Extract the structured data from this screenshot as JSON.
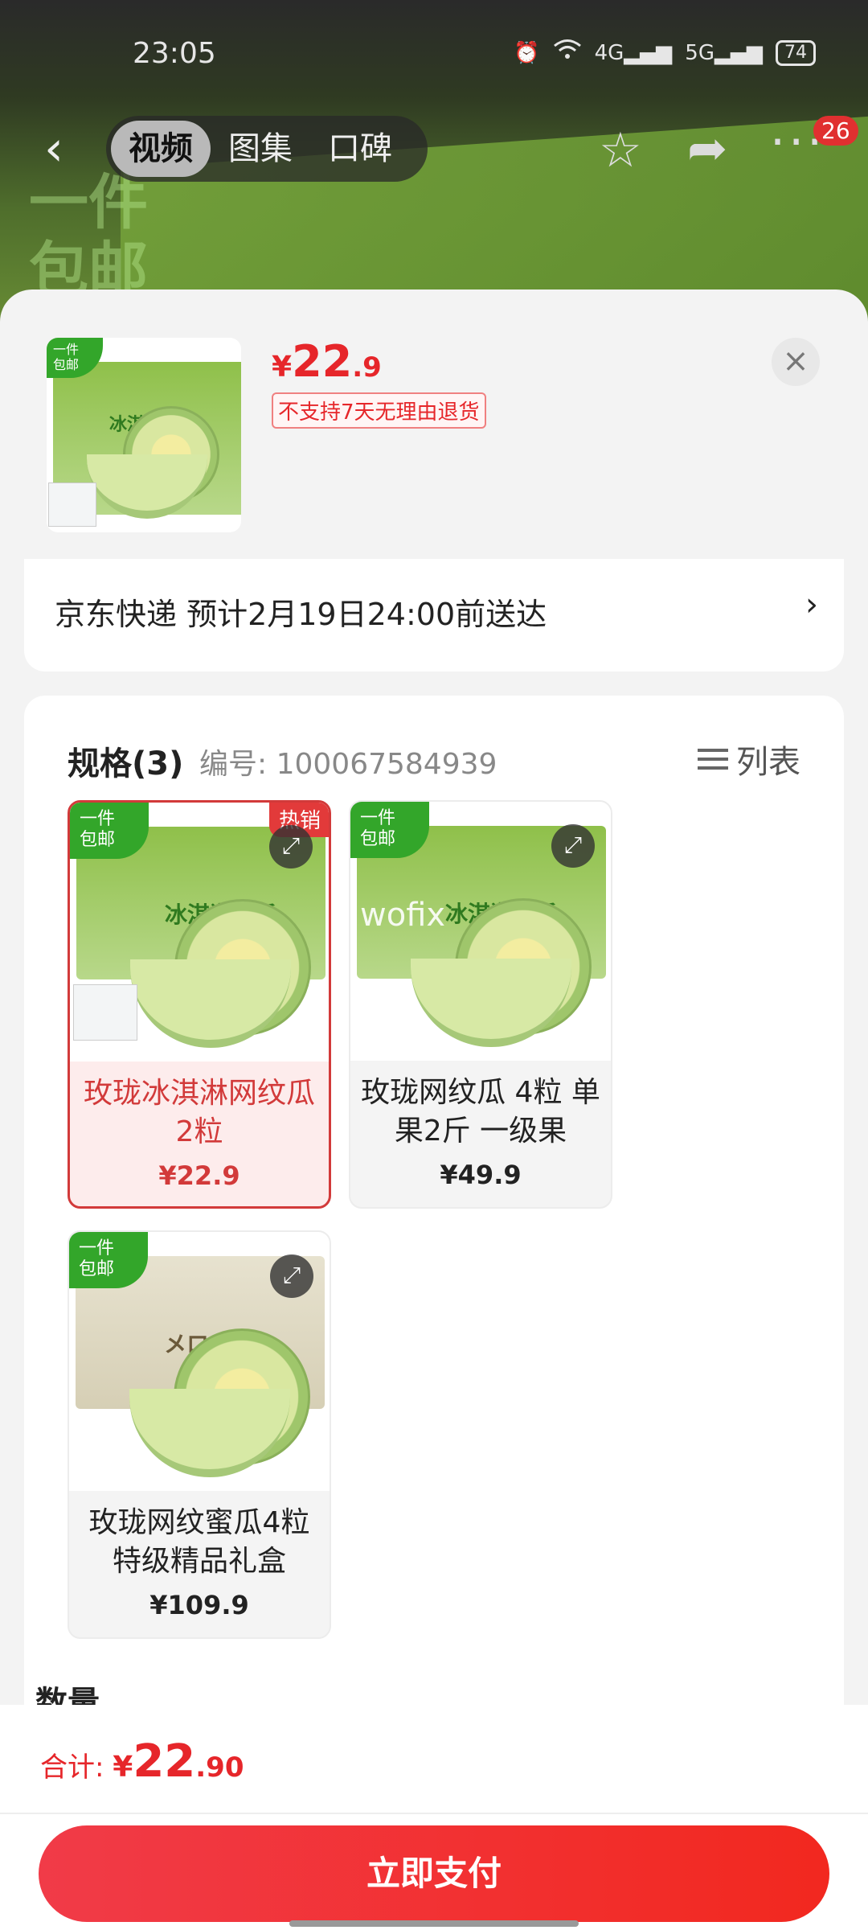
{
  "status": {
    "time": "23:05",
    "net1": "4G",
    "net2": "5G",
    "battery": "74"
  },
  "topbar": {
    "tabs": [
      "视频",
      "图集",
      "口碑"
    ],
    "active_tab": 0,
    "more_badge": "26"
  },
  "background": {
    "box_text_line1": "一件",
    "box_text_line2": "包邮"
  },
  "product": {
    "price_currency": "¥",
    "price_int": "22",
    "price_dec": ".9",
    "return_notice": "不支持7天无理由退货",
    "thumb_tag_line1": "一件",
    "thumb_tag_line2": "包邮",
    "box_label": "冰淇淋蜜瓜"
  },
  "delivery": {
    "text": "京东快递 预计2月19日24:00前送达"
  },
  "spec": {
    "title": "规格(3)",
    "code": "编号: 100067584939",
    "list_label": "列表",
    "options": [
      {
        "name": "玫珑冰淇淋网纹瓜 2粒",
        "price": "¥22.9",
        "hot": "热销",
        "tag1": "一件",
        "tag2": "包邮",
        "box_label": "冰淇淋蜜瓜",
        "selected": true
      },
      {
        "name": "玫珑网纹瓜 4粒 单果2斤  一级果",
        "price": "¥49.9",
        "tag1": "一件",
        "tag2": "包邮",
        "box_label": "冰淇淋蜜瓜",
        "watermark": "wofix",
        "selected": false
      },
      {
        "name": "玫珑网纹蜜瓜4粒 特级精品礼盒",
        "price": "¥109.9",
        "tag1": "一件",
        "tag2": "包邮",
        "box_label": "メロン",
        "selected": false
      }
    ]
  },
  "quantity": {
    "label": "数量"
  },
  "footer": {
    "total_label": "合计: ",
    "total_currency": "¥",
    "total_int": "22",
    "total_dec": ".90",
    "pay_label": "立即支付"
  },
  "colors": {
    "accent": "#e6262a",
    "selected_border": "#d23a3a",
    "pay_start": "#f13b48",
    "pay_end": "#f2281f"
  }
}
